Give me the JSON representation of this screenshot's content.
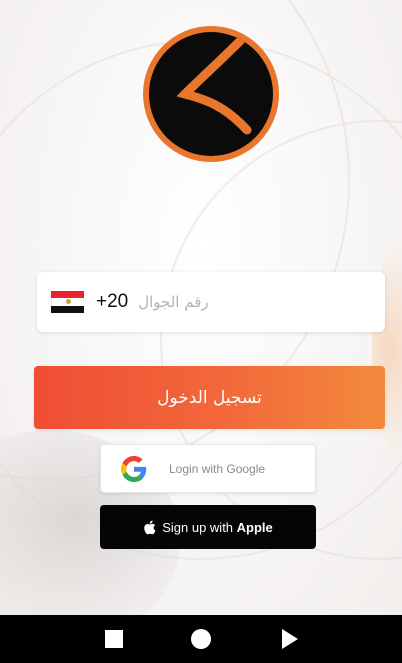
{
  "colors": {
    "accent": "#ef4d35",
    "accent_end": "#f38a3c",
    "logo_ring": "#e8762c",
    "apple_button": "#050505"
  },
  "phone": {
    "country_flag_icon": "egypt-flag-icon",
    "country_code": "+20",
    "placeholder": "رقم الجوال",
    "value": ""
  },
  "actions": {
    "login_label": "تسجيل الدخول",
    "google_label": "Login with Google",
    "google_icon": "google-g-icon",
    "apple_icon": "apple-logo-icon",
    "apple_label_prefix": "Sign up with ",
    "apple_label_brand": "Apple"
  },
  "navbar": {
    "icons": [
      "recents-square-icon",
      "home-circle-icon",
      "back-triangle-icon"
    ]
  }
}
